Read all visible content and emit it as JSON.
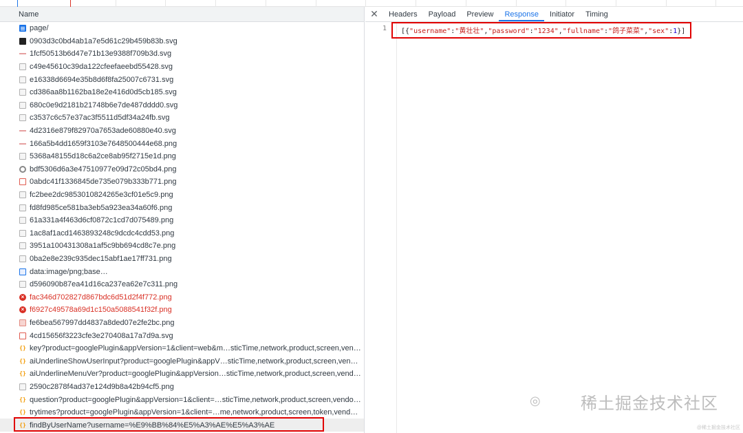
{
  "network": {
    "column_name": "Name",
    "requests": [
      {
        "name": "page/",
        "icon": "doc-icon",
        "status": "ok"
      },
      {
        "name": "0903d3c0bd4ab1a7e5d61c29b459b83b.svg",
        "icon": "image-icon",
        "status": "ok"
      },
      {
        "name": "1fcf50513b6d47e71b13e9388f709b3d.svg",
        "icon": "image-icon",
        "status": "ok"
      },
      {
        "name": "c49e45610c39da122cfeefaeebd55428.svg",
        "icon": "image-icon",
        "status": "ok"
      },
      {
        "name": "e16338d6694e35b8d6f8fa25007c6731.svg",
        "icon": "image-icon",
        "status": "ok"
      },
      {
        "name": "cd386aa8b1162ba18e2e416d0d5cb185.svg",
        "icon": "image-icon",
        "status": "ok"
      },
      {
        "name": "680c0e9d2181b21748b6e7de487dddd0.svg",
        "icon": "image-icon",
        "status": "ok"
      },
      {
        "name": "c3537c6c57e37ac3f5511d5df34a24fb.svg",
        "icon": "image-icon",
        "status": "ok"
      },
      {
        "name": "4d2316e879f82970a7653ade60880e40.svg",
        "icon": "image-icon",
        "status": "ok"
      },
      {
        "name": "166a5b4dd1659f3103e7648500444e68.png",
        "icon": "image-icon",
        "status": "ok"
      },
      {
        "name": "5368a48155d18c6a2ce8ab95f2715e1d.png",
        "icon": "image-icon",
        "status": "ok"
      },
      {
        "name": "bdf5306d6a3e47510977e09d72c05bd4.png",
        "icon": "gear-icon",
        "status": "ok"
      },
      {
        "name": "0abdc41f1336845de735e079b333b771.png",
        "icon": "image-icon",
        "status": "ok"
      },
      {
        "name": "fc2bee2dc9853010824265e3cf01e5c9.png",
        "icon": "image-icon",
        "status": "ok"
      },
      {
        "name": "fd8fd985ce581ba3eb5a923ea34a60f6.png",
        "icon": "image-icon",
        "status": "ok"
      },
      {
        "name": "61a331a4f463d6cf0872c1cd7d075489.png",
        "icon": "image-icon",
        "status": "ok"
      },
      {
        "name": "1ac8af1acd1463893248c9dcdc4cdd53.png",
        "icon": "image-icon",
        "status": "ok"
      },
      {
        "name": "3951a100431308a1af5c9bb694cd8c7e.png",
        "icon": "image-icon",
        "status": "ok"
      },
      {
        "name": "0ba2e8e239c935dec15abf1ae17ff731.png",
        "icon": "image-icon",
        "status": "ok"
      },
      {
        "name": "data:image/png;base…",
        "icon": "data-icon",
        "status": "ok"
      },
      {
        "name": "d596090b87ea41d16ca237ea62e7c311.png",
        "icon": "image-icon",
        "status": "ok"
      },
      {
        "name": "fac346d702827d867bdc6d51d2f4f772.png",
        "icon": "error-icon",
        "status": "error"
      },
      {
        "name": "f6927c49578a69d1c150a5088541f32f.png",
        "icon": "error-icon",
        "status": "error"
      },
      {
        "name": "fe6bea567997dd4837a8ded07e2fe2bc.png",
        "icon": "image-icon",
        "status": "ok"
      },
      {
        "name": "4cd15656f3223cfe3e270408a17a7d9a.svg",
        "icon": "image-icon",
        "status": "ok"
      },
      {
        "name": "key?product=googlePlugin&appVersion=1&client=web&m…sticTime,network,product,screen,vendo…",
        "icon": "xhr-icon",
        "status": "ok"
      },
      {
        "name": "aiUnderlineShowUserInput?product=googlePlugin&appV…sticTime,network,product,screen,vendor,…",
        "icon": "xhr-icon",
        "status": "ok"
      },
      {
        "name": "aiUnderlineMenuVer?product=googlePlugin&appVersion…sticTime,network,product,screen,vendor,…",
        "icon": "xhr-icon",
        "status": "ok"
      },
      {
        "name": "2590c2878f4ad37e124d9b8a42b94cf5.png",
        "icon": "image-icon",
        "status": "ok"
      },
      {
        "name": "question?product=googlePlugin&appVersion=1&client=…sticTime,network,product,screen,vendor,y…",
        "icon": "xhr-icon",
        "status": "ok"
      },
      {
        "name": "trytimes?product=googlePlugin&appVersion=1&client=…me,network,product,screen,token,vendor,y…",
        "icon": "xhr-icon",
        "status": "ok"
      },
      {
        "name": "findByUserName?username=%E9%BB%84%E5%A3%AE%E5%A3%AE",
        "icon": "xhr-icon",
        "status": "ok"
      }
    ]
  },
  "details": {
    "close_symbol": "✕",
    "tabs": [
      "Headers",
      "Payload",
      "Preview",
      "Response",
      "Initiator",
      "Timing"
    ],
    "active_tab": "Response",
    "line_number": "1",
    "response": {
      "open": "[{",
      "k1": "\"username\"",
      "v1": "\"黄壮壮\"",
      "k2": "\"password\"",
      "v2": "\"1234\"",
      "k3": "\"fullname\"",
      "v3": "\"鸽子菜菜\"",
      "k4": "\"sex\"",
      "v4": "1",
      "close": "}]"
    }
  },
  "watermark": {
    "text": "稀土掘金技术社区",
    "small": "@稀土掘金技术社区",
    "icon": "wechat-icon"
  },
  "colors": {
    "accent": "#1a73e8",
    "error": "#d93025",
    "highlight_box": "#e00000"
  }
}
